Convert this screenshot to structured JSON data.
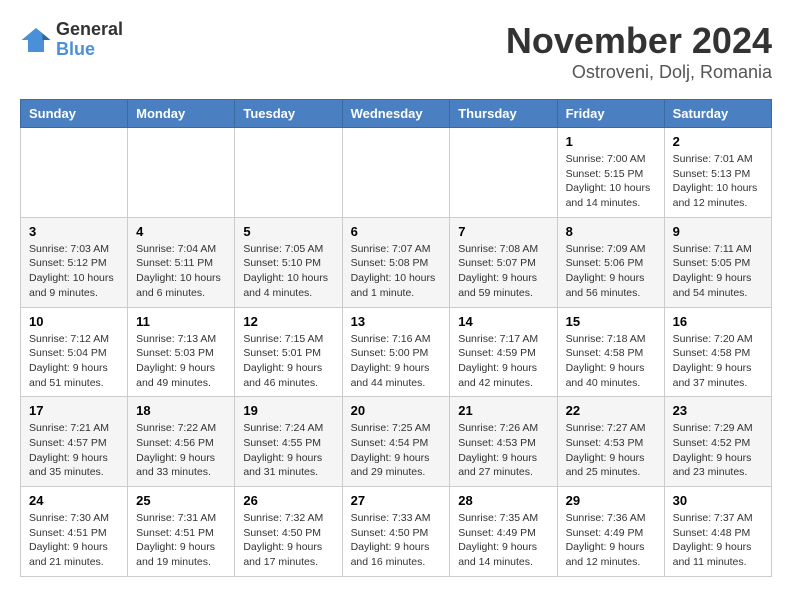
{
  "header": {
    "logo": {
      "general": "General",
      "blue": "Blue"
    },
    "title": "November 2024",
    "location": "Ostroveni, Dolj, Romania"
  },
  "calendar": {
    "days_of_week": [
      "Sunday",
      "Monday",
      "Tuesday",
      "Wednesday",
      "Thursday",
      "Friday",
      "Saturday"
    ],
    "weeks": [
      [
        {
          "day": "",
          "info": ""
        },
        {
          "day": "",
          "info": ""
        },
        {
          "day": "",
          "info": ""
        },
        {
          "day": "",
          "info": ""
        },
        {
          "day": "",
          "info": ""
        },
        {
          "day": "1",
          "info": "Sunrise: 7:00 AM\nSunset: 5:15 PM\nDaylight: 10 hours and 14 minutes."
        },
        {
          "day": "2",
          "info": "Sunrise: 7:01 AM\nSunset: 5:13 PM\nDaylight: 10 hours and 12 minutes."
        }
      ],
      [
        {
          "day": "3",
          "info": "Sunrise: 7:03 AM\nSunset: 5:12 PM\nDaylight: 10 hours and 9 minutes."
        },
        {
          "day": "4",
          "info": "Sunrise: 7:04 AM\nSunset: 5:11 PM\nDaylight: 10 hours and 6 minutes."
        },
        {
          "day": "5",
          "info": "Sunrise: 7:05 AM\nSunset: 5:10 PM\nDaylight: 10 hours and 4 minutes."
        },
        {
          "day": "6",
          "info": "Sunrise: 7:07 AM\nSunset: 5:08 PM\nDaylight: 10 hours and 1 minute."
        },
        {
          "day": "7",
          "info": "Sunrise: 7:08 AM\nSunset: 5:07 PM\nDaylight: 9 hours and 59 minutes."
        },
        {
          "day": "8",
          "info": "Sunrise: 7:09 AM\nSunset: 5:06 PM\nDaylight: 9 hours and 56 minutes."
        },
        {
          "day": "9",
          "info": "Sunrise: 7:11 AM\nSunset: 5:05 PM\nDaylight: 9 hours and 54 minutes."
        }
      ],
      [
        {
          "day": "10",
          "info": "Sunrise: 7:12 AM\nSunset: 5:04 PM\nDaylight: 9 hours and 51 minutes."
        },
        {
          "day": "11",
          "info": "Sunrise: 7:13 AM\nSunset: 5:03 PM\nDaylight: 9 hours and 49 minutes."
        },
        {
          "day": "12",
          "info": "Sunrise: 7:15 AM\nSunset: 5:01 PM\nDaylight: 9 hours and 46 minutes."
        },
        {
          "day": "13",
          "info": "Sunrise: 7:16 AM\nSunset: 5:00 PM\nDaylight: 9 hours and 44 minutes."
        },
        {
          "day": "14",
          "info": "Sunrise: 7:17 AM\nSunset: 4:59 PM\nDaylight: 9 hours and 42 minutes."
        },
        {
          "day": "15",
          "info": "Sunrise: 7:18 AM\nSunset: 4:58 PM\nDaylight: 9 hours and 40 minutes."
        },
        {
          "day": "16",
          "info": "Sunrise: 7:20 AM\nSunset: 4:58 PM\nDaylight: 9 hours and 37 minutes."
        }
      ],
      [
        {
          "day": "17",
          "info": "Sunrise: 7:21 AM\nSunset: 4:57 PM\nDaylight: 9 hours and 35 minutes."
        },
        {
          "day": "18",
          "info": "Sunrise: 7:22 AM\nSunset: 4:56 PM\nDaylight: 9 hours and 33 minutes."
        },
        {
          "day": "19",
          "info": "Sunrise: 7:24 AM\nSunset: 4:55 PM\nDaylight: 9 hours and 31 minutes."
        },
        {
          "day": "20",
          "info": "Sunrise: 7:25 AM\nSunset: 4:54 PM\nDaylight: 9 hours and 29 minutes."
        },
        {
          "day": "21",
          "info": "Sunrise: 7:26 AM\nSunset: 4:53 PM\nDaylight: 9 hours and 27 minutes."
        },
        {
          "day": "22",
          "info": "Sunrise: 7:27 AM\nSunset: 4:53 PM\nDaylight: 9 hours and 25 minutes."
        },
        {
          "day": "23",
          "info": "Sunrise: 7:29 AM\nSunset: 4:52 PM\nDaylight: 9 hours and 23 minutes."
        }
      ],
      [
        {
          "day": "24",
          "info": "Sunrise: 7:30 AM\nSunset: 4:51 PM\nDaylight: 9 hours and 21 minutes."
        },
        {
          "day": "25",
          "info": "Sunrise: 7:31 AM\nSunset: 4:51 PM\nDaylight: 9 hours and 19 minutes."
        },
        {
          "day": "26",
          "info": "Sunrise: 7:32 AM\nSunset: 4:50 PM\nDaylight: 9 hours and 17 minutes."
        },
        {
          "day": "27",
          "info": "Sunrise: 7:33 AM\nSunset: 4:50 PM\nDaylight: 9 hours and 16 minutes."
        },
        {
          "day": "28",
          "info": "Sunrise: 7:35 AM\nSunset: 4:49 PM\nDaylight: 9 hours and 14 minutes."
        },
        {
          "day": "29",
          "info": "Sunrise: 7:36 AM\nSunset: 4:49 PM\nDaylight: 9 hours and 12 minutes."
        },
        {
          "day": "30",
          "info": "Sunrise: 7:37 AM\nSunset: 4:48 PM\nDaylight: 9 hours and 11 minutes."
        }
      ]
    ]
  }
}
